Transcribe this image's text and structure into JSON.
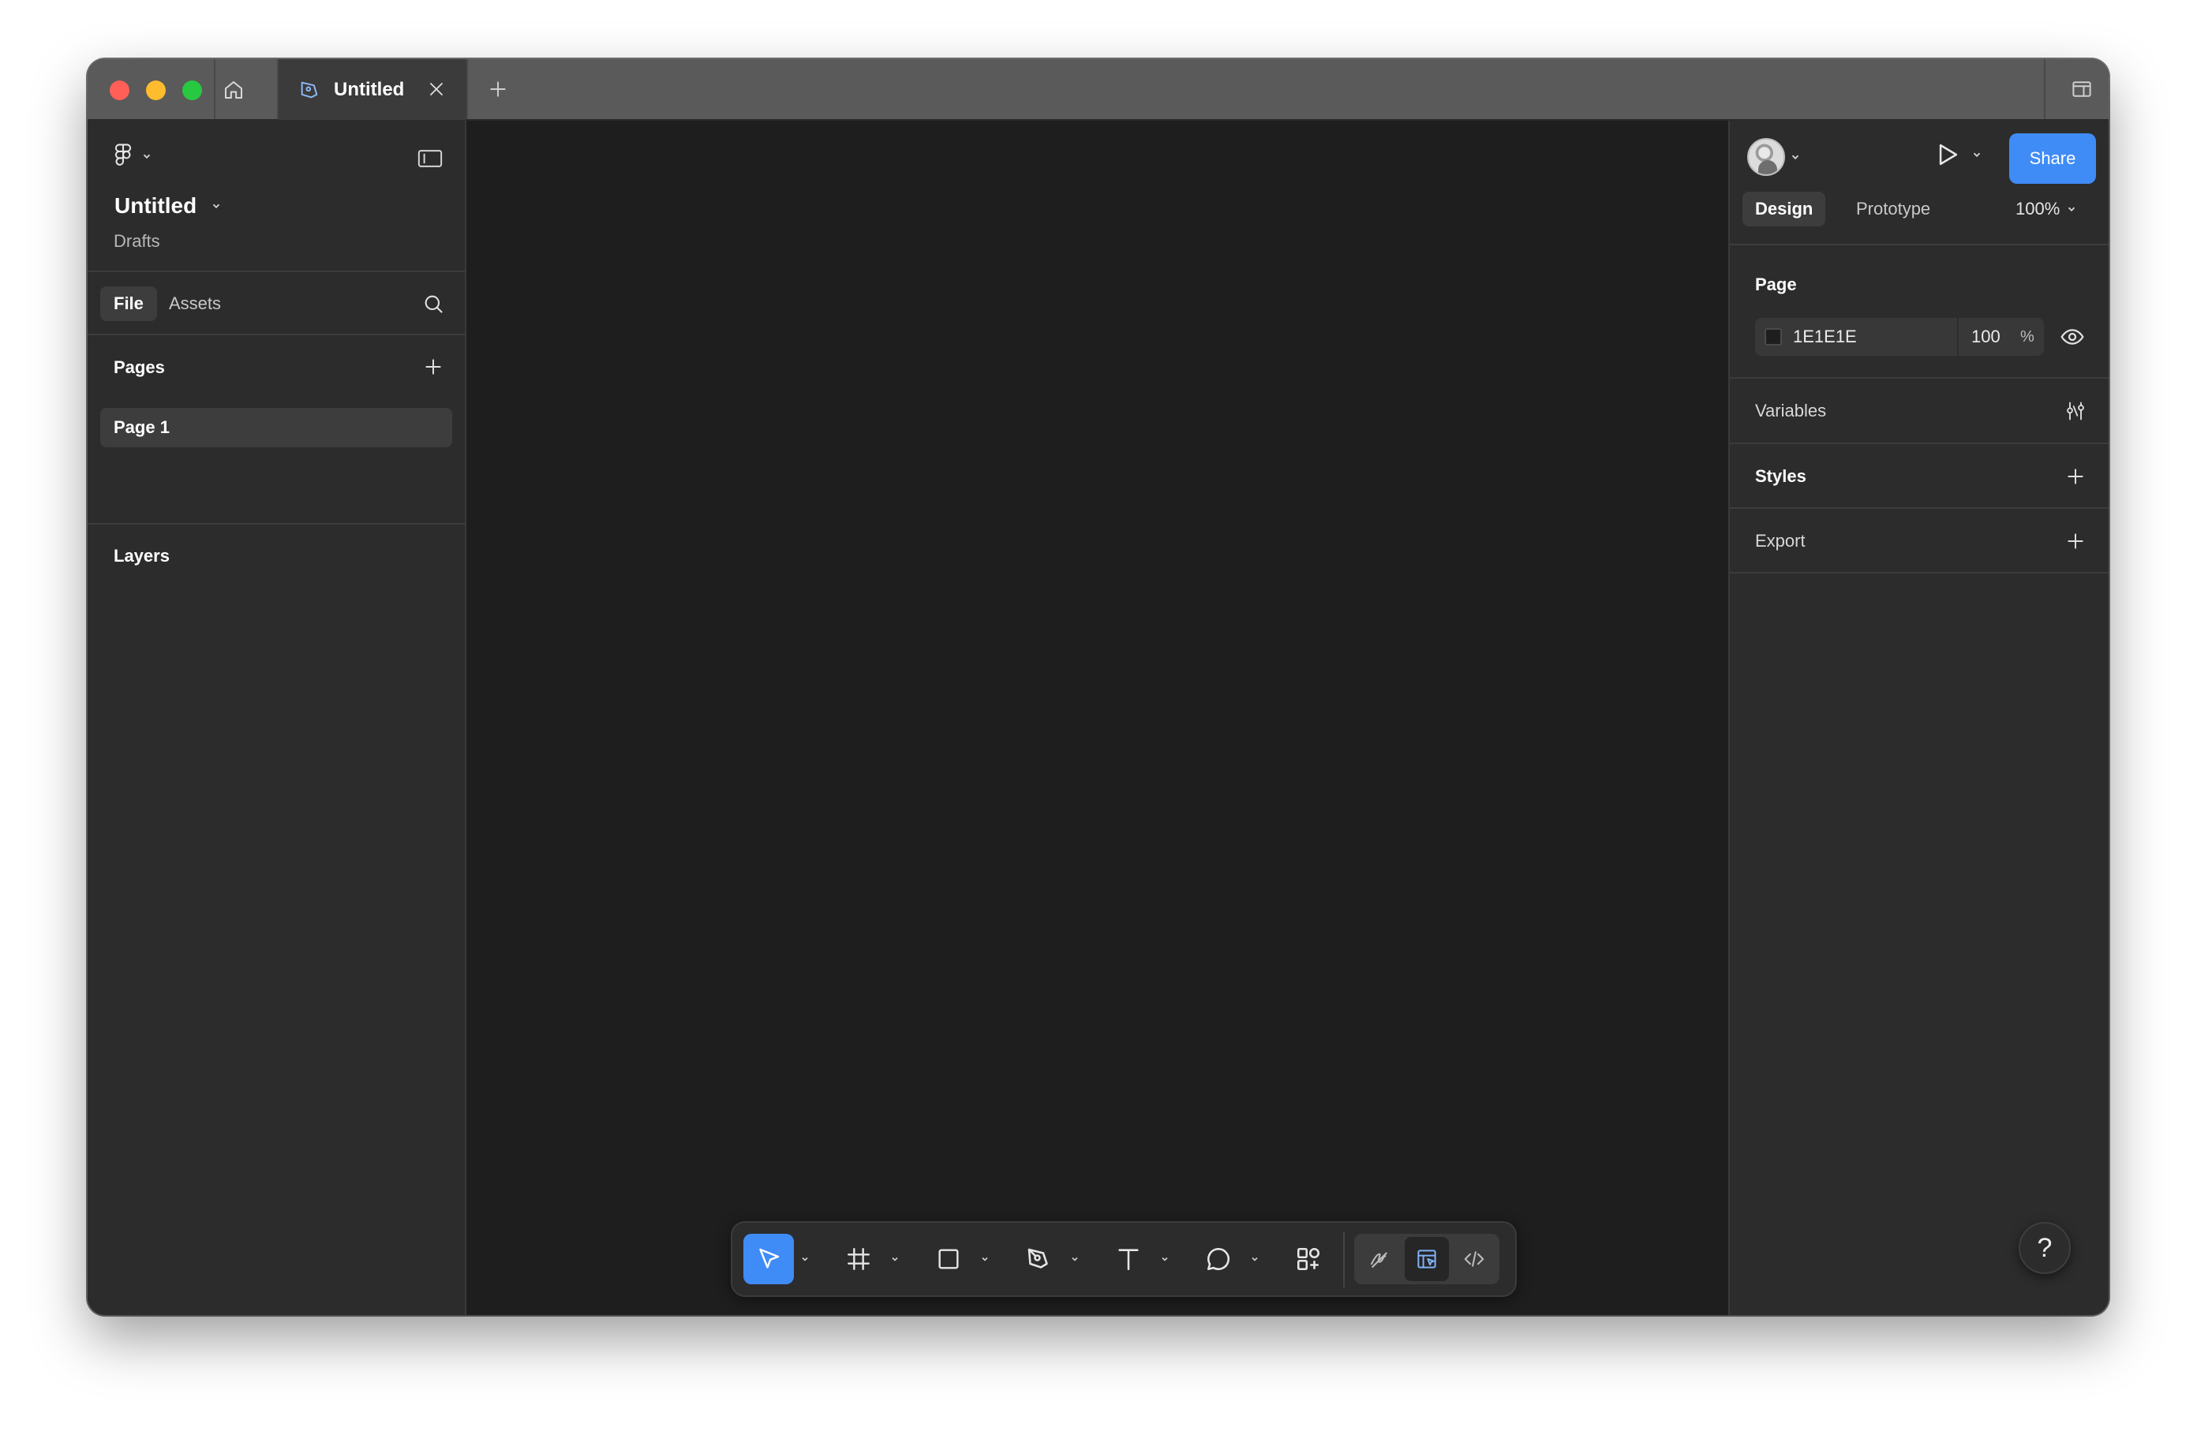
{
  "colors": {
    "accent": "#3f8cf7",
    "titlebar": "#5a5a5a",
    "panel": "#2c2c2c",
    "canvas": "#1e1e1e",
    "traffic_red": "#ff5f57",
    "traffic_yellow": "#febc2e",
    "traffic_green": "#28c840"
  },
  "titlebar": {
    "tab_title": "Untitled",
    "icons": [
      "home-icon",
      "design-file-icon",
      "close-icon",
      "plus-icon",
      "sidebar-window-icon"
    ]
  },
  "left_panel": {
    "file_name": "Untitled",
    "location": "Drafts",
    "tabs": [
      {
        "label": "File",
        "active": true
      },
      {
        "label": "Assets",
        "active": false
      }
    ],
    "pages_heading": "Pages",
    "pages": [
      {
        "label": "Page 1",
        "selected": true
      }
    ],
    "layers_heading": "Layers"
  },
  "toolbar": {
    "tools": [
      {
        "name": "move-tool",
        "icon": "cursor-icon",
        "active": true
      },
      {
        "name": "frame-tool",
        "icon": "frame-icon",
        "active": false
      },
      {
        "name": "shape-tool",
        "icon": "rectangle-icon",
        "active": false
      },
      {
        "name": "pen-tool",
        "icon": "pen-icon",
        "active": false
      },
      {
        "name": "text-tool",
        "icon": "text-icon",
        "active": false
      },
      {
        "name": "comment-tool",
        "icon": "comment-icon",
        "active": false
      },
      {
        "name": "actions-tool",
        "icon": "actions-icon",
        "active": false
      }
    ],
    "modes": [
      {
        "name": "draw-mode",
        "icon": "draw-icon",
        "active": false
      },
      {
        "name": "design-mode",
        "icon": "design-mode-icon",
        "active": true
      },
      {
        "name": "dev-mode",
        "icon": "code-icon",
        "active": false
      }
    ]
  },
  "right_panel": {
    "share_label": "Share",
    "tabs": [
      {
        "label": "Design",
        "active": true
      },
      {
        "label": "Prototype",
        "active": false
      }
    ],
    "zoom": "100%",
    "page_section": {
      "title": "Page",
      "bg_hex": "1E1E1E",
      "opacity": "100",
      "opacity_unit": "%"
    },
    "variables_label": "Variables",
    "styles_label": "Styles",
    "export_label": "Export",
    "help_label": "?"
  }
}
